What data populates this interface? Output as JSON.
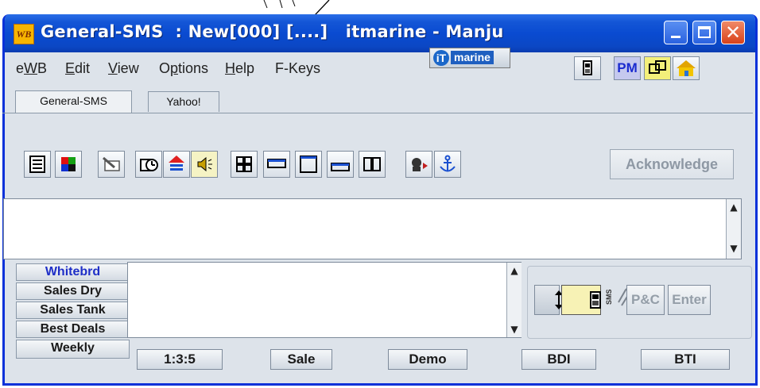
{
  "window": {
    "title": "General-SMS  : New[000] [....]   itmarine - Manju",
    "app_icon_text": "WB"
  },
  "menu": {
    "items": [
      {
        "label": "eWB",
        "mnemonic_index": 1
      },
      {
        "label": "Edit",
        "mnemonic_index": 0
      },
      {
        "label": "View",
        "mnemonic_index": 0
      },
      {
        "label": "Options",
        "mnemonic_index": 1
      },
      {
        "label": "Help",
        "mnemonic_index": 0
      },
      {
        "label": "F-Keys",
        "mnemonic_index": -1
      }
    ]
  },
  "logo": {
    "badge": "iT",
    "text": "marine"
  },
  "header_buttons": [
    {
      "name": "phone-icon"
    },
    {
      "name": "pm-button",
      "label": "PM"
    },
    {
      "name": "contacts-icon"
    },
    {
      "name": "home-icon"
    }
  ],
  "tabs": [
    {
      "label": "General-SMS",
      "active": true
    },
    {
      "label": "Yahoo!",
      "active": false
    }
  ],
  "toolbar": {
    "buttons": [
      "document-icon",
      "color-grid-icon",
      "edit-card-icon",
      "schedule-icon",
      "upload-icon",
      "speaker-icon",
      "grid-layout-icon",
      "top-pane-icon",
      "window-icon",
      "bottom-pane-icon",
      "columns-icon",
      "agent-icon",
      "anchor-icon"
    ],
    "acknowledge_label": "Acknowledge"
  },
  "side_buttons": [
    "Whitebrd",
    "Sales Dry",
    "Sales Tank",
    "Best Deals",
    "Weekly"
  ],
  "sms_controls": {
    "pc_label": "P&C",
    "enter_label": "Enter"
  },
  "bottom_buttons": [
    "1:3:5",
    "Sale",
    "Demo",
    "BDI",
    "BTI"
  ],
  "colors": {
    "title_bar": "#0a4bd1",
    "window_bg": "#dde3ea",
    "accent_blue": "#1e2ec7",
    "close_button": "#d9421a"
  }
}
